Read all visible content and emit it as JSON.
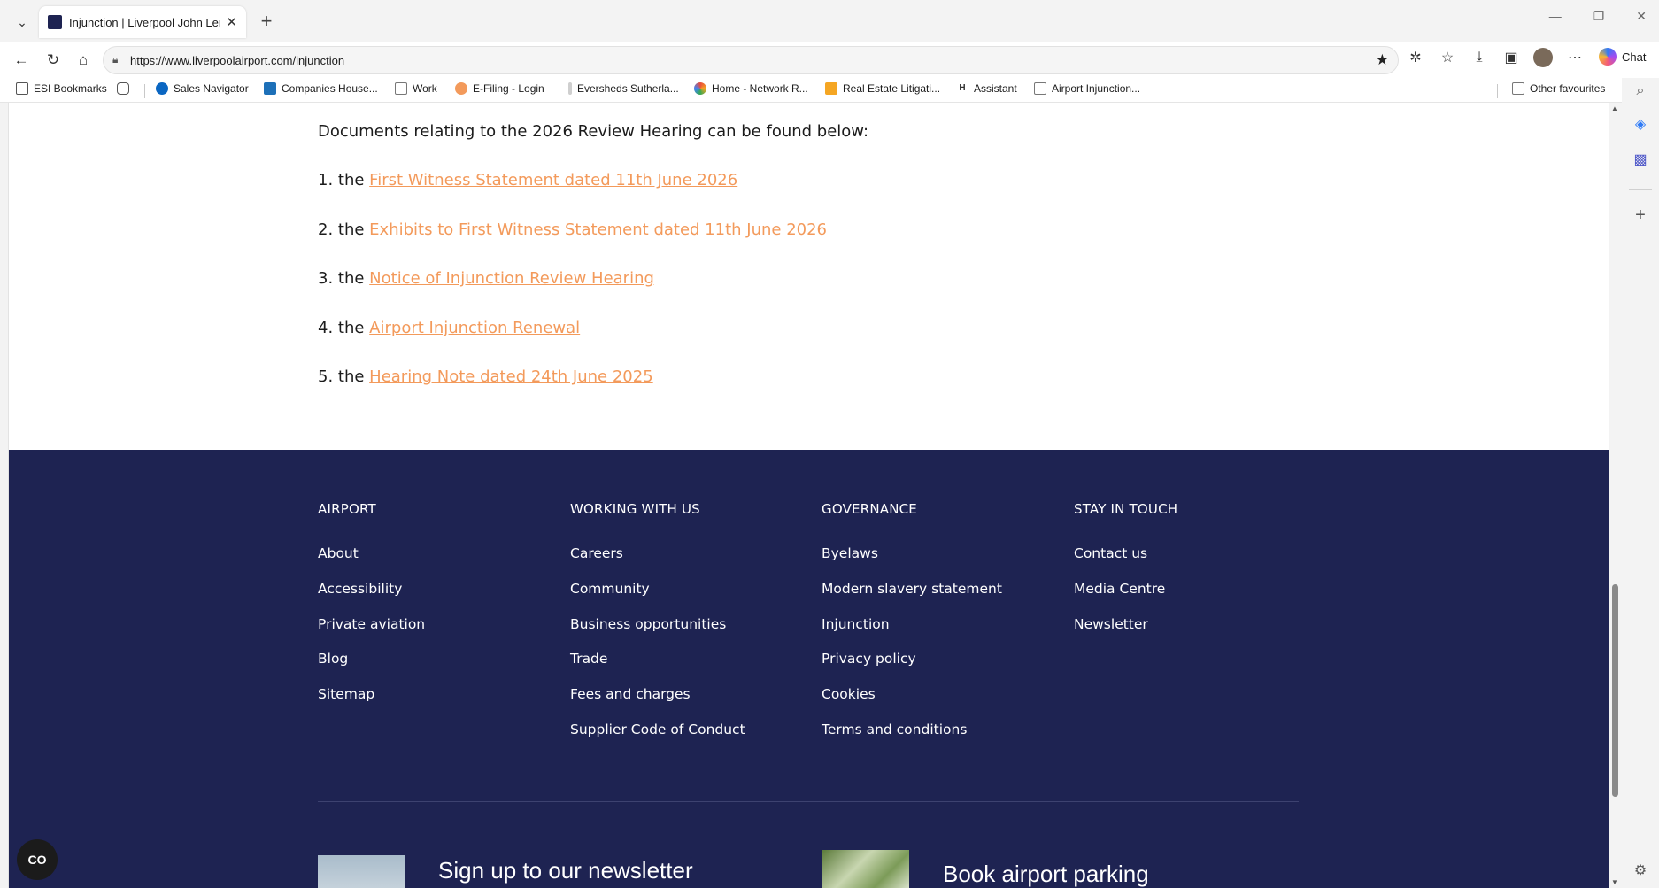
{
  "browser": {
    "tab_title": "Injunction | Liverpool John Lennon",
    "url": "https://www.liverpoolairport.com/injunction",
    "chat_label": "Chat",
    "bookmarks": [
      {
        "label": "ESI Bookmarks",
        "color": "#555555"
      },
      {
        "label": "Sales Navigator",
        "color": "#0a66c2"
      },
      {
        "label": "Companies House...",
        "color": "#1d70b8"
      },
      {
        "label": "Work",
        "color": "#777777"
      },
      {
        "label": "E-Filing - Login",
        "color": "#f39a5b"
      },
      {
        "label": "Eversheds Sutherla...",
        "color": "#999999"
      },
      {
        "label": "Home - Network R...",
        "color": "#e94b3c"
      },
      {
        "label": "Real Estate Litigati...",
        "color": "#f5a623"
      },
      {
        "label": "Assistant",
        "color": "#333333"
      },
      {
        "label": "Airport Injunction...",
        "color": "#777777"
      }
    ],
    "other_favourites": "Other favourites"
  },
  "page": {
    "intro": "Documents relating to the 2026 Review Hearing can be found below:",
    "documents": [
      {
        "prefix": "1. the ",
        "link": "First Witness Statement dated 11th June 2026"
      },
      {
        "prefix": "2. the ",
        "link": "Exhibits to First Witness Statement dated 11th June 2026"
      },
      {
        "prefix": "3. the ",
        "link": "Notice of Injunction Review Hearing"
      },
      {
        "prefix": "4. the ",
        "link": "Airport Injunction Renewal"
      },
      {
        "prefix": "5. the ",
        "link": "Hearing Note dated 24th June 2025"
      }
    ],
    "link_color": "#f39a5b"
  },
  "footer": {
    "background": "#1e2352",
    "columns": [
      {
        "heading": "AIRPORT",
        "links": [
          "About",
          "Accessibility",
          "Private aviation",
          "Blog",
          "Sitemap"
        ]
      },
      {
        "heading": "WORKING WITH US",
        "links": [
          "Careers",
          "Community",
          "Business opportunities",
          "Trade",
          "Fees and charges",
          "Supplier Code of Conduct"
        ]
      },
      {
        "heading": "GOVERNANCE",
        "links": [
          "Byelaws",
          "Modern slavery statement",
          "Injunction",
          "Privacy policy",
          "Cookies",
          "Terms and conditions"
        ]
      },
      {
        "heading": "STAY IN TOUCH",
        "links": [
          "Contact us",
          "Media Centre",
          "Newsletter"
        ]
      }
    ],
    "promo_newsletter": "Sign up to our newsletter",
    "promo_parking": "Book airport parking"
  },
  "accessibility_button": "CO"
}
